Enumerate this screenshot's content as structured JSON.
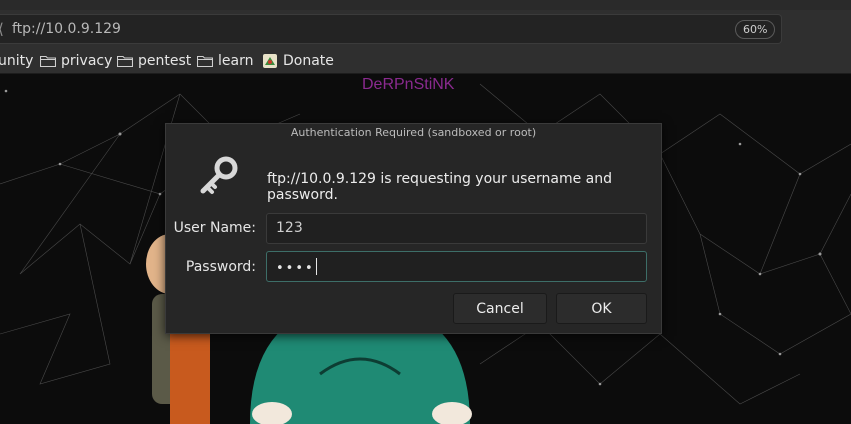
{
  "browser": {
    "url": "ftp://10.0.9.129",
    "zoom": "60%",
    "bookmarks": [
      {
        "label": "unity"
      },
      {
        "label": "privacy"
      },
      {
        "label": "pentest"
      },
      {
        "label": "learn"
      },
      {
        "label": "Donate"
      }
    ]
  },
  "page": {
    "title": "DeRPnStiNK",
    "bg_color": "#0c0c0c",
    "title_color": "#8a2a8f"
  },
  "dialog": {
    "title": "Authentication Required (sandboxed or root)",
    "icon": "key-icon",
    "message": "ftp://10.0.9.129 is requesting your username and password.",
    "username_label": "User Name:",
    "username_value": "123",
    "password_label": "Password:",
    "password_value": "••••",
    "cancel_label": "Cancel",
    "ok_label": "OK",
    "focus_color": "#3d6e68"
  }
}
